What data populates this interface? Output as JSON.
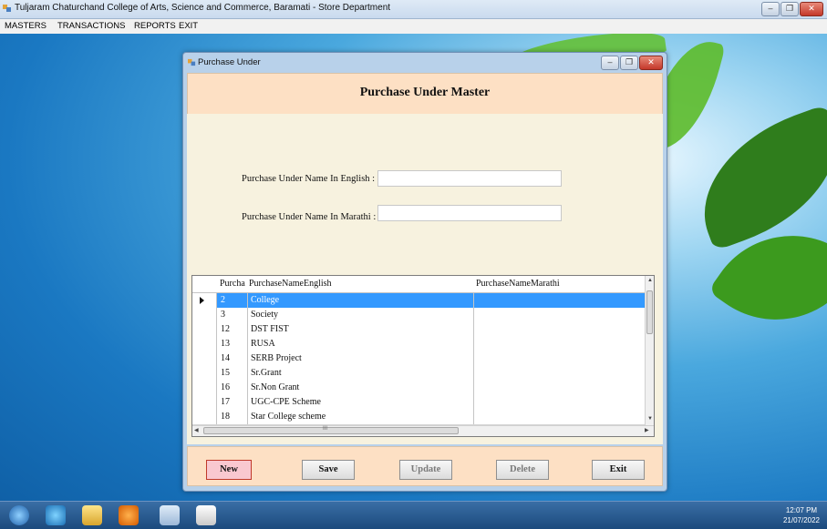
{
  "app": {
    "title": "Tuljaram Chaturchand College of Arts, Science and Commerce, Baramati - Store Department",
    "menu": [
      "MASTERS",
      "TRANSACTIONS",
      "REPORTS",
      "EXIT"
    ]
  },
  "dialog": {
    "title": "Purchase Under",
    "header": "Purchase Under Master",
    "english_label": "Purchase Under Name In English :",
    "english_value": "",
    "marathi_label": "Purchase Under Name In Marathi :",
    "marathi_value": ""
  },
  "grid": {
    "columns": [
      "Purcha",
      "PurchaseNameEnglish",
      "PurchaseNameMarathi"
    ],
    "rows": [
      {
        "id": "2",
        "english": "College",
        "marathi": ""
      },
      {
        "id": "3",
        "english": "Society",
        "marathi": ""
      },
      {
        "id": "12",
        "english": "DST FIST",
        "marathi": ""
      },
      {
        "id": "13",
        "english": "RUSA",
        "marathi": ""
      },
      {
        "id": "14",
        "english": "SERB Project",
        "marathi": ""
      },
      {
        "id": "15",
        "english": "Sr.Grant",
        "marathi": ""
      },
      {
        "id": "16",
        "english": "Sr.Non Grant",
        "marathi": ""
      },
      {
        "id": "17",
        "english": "UGC-CPE Scheme",
        "marathi": ""
      },
      {
        "id": "18",
        "english": "Star College scheme",
        "marathi": ""
      }
    ],
    "selected_row": 0,
    "scroll_arrow": "III"
  },
  "buttons": {
    "new": "New",
    "save": "Save",
    "update": "Update",
    "delete": "Delete",
    "exit": "Exit"
  },
  "tray": {
    "time": "12:07 PM",
    "date": "21/07/2022"
  },
  "colors": {
    "header_bg": "#fde0c4",
    "form_bg": "#f7f2df",
    "selection": "#3399ff"
  }
}
